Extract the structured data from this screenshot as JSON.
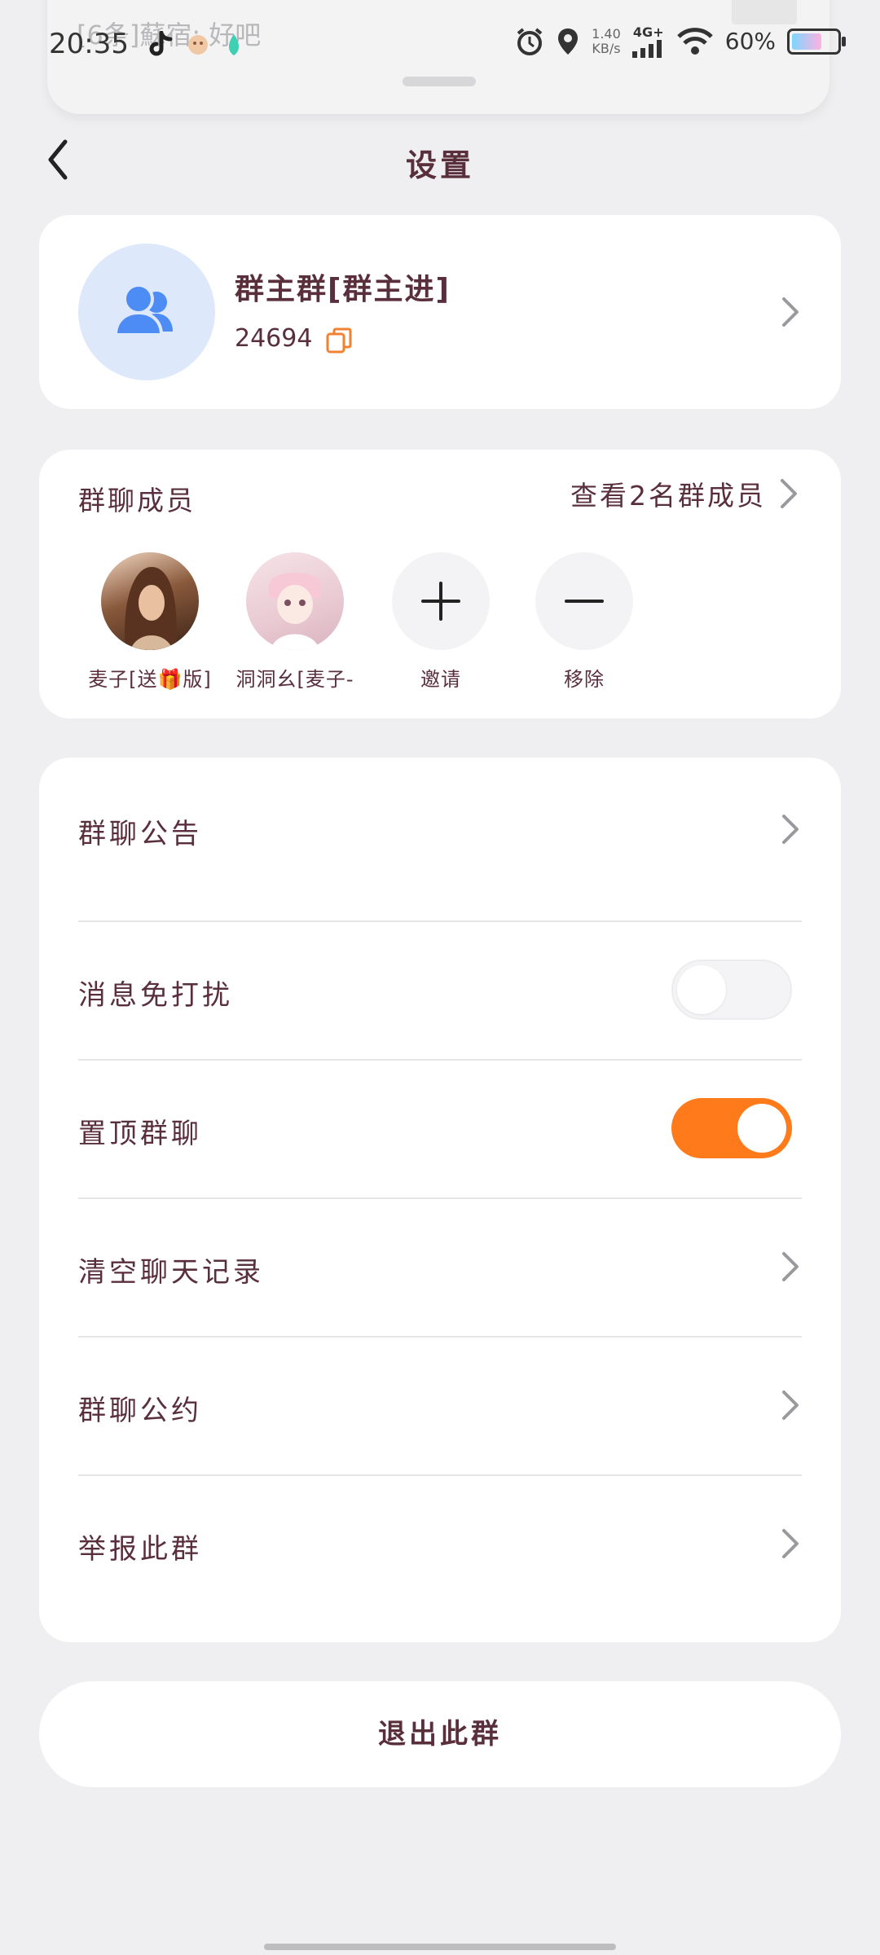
{
  "status_bar": {
    "time": "20:35",
    "speed_value": "1.40",
    "speed_unit": "KB/s",
    "network": "4G+",
    "battery": "60%"
  },
  "notification": {
    "text": "[6条]蘇宿: 好吧"
  },
  "header": {
    "title": "设置"
  },
  "group": {
    "name": "群主群[群主进]",
    "id": "24694"
  },
  "members": {
    "title": "群聊成员",
    "view_all": "查看2名群成员",
    "list": [
      {
        "name": "麦子[送🎁版]"
      },
      {
        "name": "洞洞幺[麦子-"
      }
    ],
    "invite_label": "邀请",
    "remove_label": "移除"
  },
  "settings": {
    "announcement": "群聊公告",
    "do_not_disturb": "消息免打扰",
    "do_not_disturb_on": false,
    "pin_chat": "置顶群聊",
    "pin_chat_on": true,
    "clear_history": "清空聊天记录",
    "rules": "群聊公约",
    "report": "举报此群"
  },
  "exit_label": "退出此群",
  "colors": {
    "accent": "#ff7a1a",
    "text": "#5a2f3c",
    "background": "#efeff1",
    "avatar_bg": "#dde8fa",
    "avatar_icon": "#4d8cf5"
  }
}
